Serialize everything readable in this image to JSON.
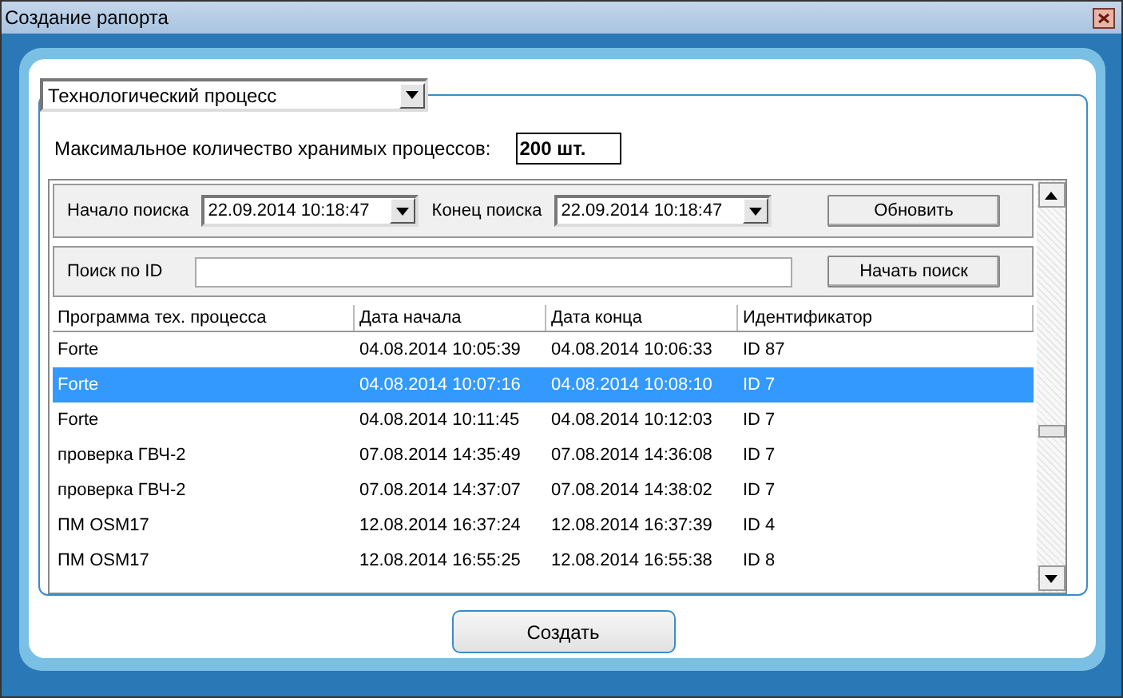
{
  "window": {
    "title": "Создание рапорта"
  },
  "process_select": {
    "value": "Технологический процесс"
  },
  "max_processes": {
    "label": "Максимальное количество хранимых процессов:",
    "value": "200 шт."
  },
  "search": {
    "start_label": "Начало поиска",
    "start_value": "22.09.2014 10:18:47",
    "end_label": "Конец поиска",
    "end_value": "22.09.2014 10:18:47",
    "refresh_button": "Обновить"
  },
  "id_search": {
    "label": "Поиск по ID",
    "button": "Начать поиск"
  },
  "table": {
    "columns": [
      "Программа тех. процесса",
      "Дата начала",
      "Дата конца",
      "Идентификатор"
    ],
    "rows": [
      {
        "cells": [
          "Forte",
          "04.08.2014 10:05:39",
          "04.08.2014 10:06:33",
          "ID 87"
        ],
        "selected": false
      },
      {
        "cells": [
          "Forte",
          "04.08.2014 10:07:16",
          "04.08.2014 10:08:10",
          "ID 7"
        ],
        "selected": true
      },
      {
        "cells": [
          "Forte",
          "04.08.2014 10:11:45",
          "04.08.2014 10:12:03",
          "ID 7"
        ],
        "selected": false
      },
      {
        "cells": [
          "проверка ГВЧ-2",
          "07.08.2014 14:35:49",
          "07.08.2014 14:36:08",
          "ID 7"
        ],
        "selected": false
      },
      {
        "cells": [
          "проверка ГВЧ-2",
          "07.08.2014 14:37:07",
          "07.08.2014 14:38:02",
          "ID 7"
        ],
        "selected": false
      },
      {
        "cells": [
          "ПМ OSM17",
          "12.08.2014 16:37:24",
          "12.08.2014 16:37:39",
          "ID 4"
        ],
        "selected": false
      },
      {
        "cells": [
          "ПМ OSM17",
          "12.08.2014 16:55:25",
          "12.08.2014 16:55:38",
          "ID 8"
        ],
        "selected": false
      }
    ]
  },
  "create_button": "Создать"
}
